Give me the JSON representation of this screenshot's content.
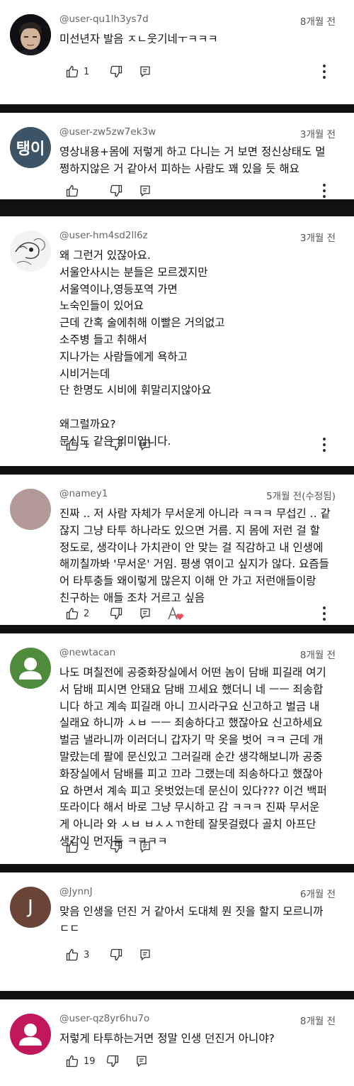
{
  "comments": [
    {
      "handle": "@user-qu1lh3ys7d",
      "time": "8개월 전",
      "text": "미선년자 발음 ㅈㄴ웃기네ㅜㅋㅋㅋ",
      "likes": "1",
      "avatar": "photo-portrait"
    },
    {
      "handle": "@user-zw5zw7ek3w",
      "time": "3개월 전",
      "text": "영상내용+몸에 저렇게 하고 다니는 거 보면 정신상태도 멀\n쩡하지않은 거 같아서 피하는 사람도 꽤 있을 듯 해요",
      "likes": "",
      "avatar_text": "탱이",
      "avatar_color": "#3d5466"
    },
    {
      "handle": "@user-hm4sd2ll6z",
      "time": "3개월 전",
      "text": "왜 그런거 있잖아요.\n서울안사시는 분들은 모르겠지만\n서울역이나,영등포역 가면\n노숙인들이 있어요\n근데 간혹 술에취해 이빨은 거의없고\n소주병 들고 취해서\n지나가는 사람들에게 욕하고\n시비거는데\n단 한명도 시비에 휘말리지않아요\n\n왜그럴까요?\n문신도 같은 의미입니다.",
      "likes": "1",
      "avatar": "sketch-drawing"
    },
    {
      "handle": "@namey1",
      "time": "5개월 전(수정됨)",
      "text": "진짜 .. 저 사람 자체가 무서운게 아니라 ㅋㅋㅋ 무섭긴 .. 같\n잖지 그냥 타투 하나라도 있으면 거름. 지 몸에 저런 걸 할\n정도로, 생각이나 가치관이 안 맞는 걸 직감하고 내 인생에\n해끼칠까봐 '무서운' 거임. 평생 엮이고 싶지가 않다. 요즘들\n어 타투충들 왜이렇게 많은지 이해 안 가고 저런애들이랑\n친구하는 애들 조차 거르고 싶음",
      "likes": "2",
      "avatar_color": "#b39a98",
      "creator_heart": true
    },
    {
      "handle": "@newtacan",
      "time": "8개월 전",
      "text": "나도 며칠전에 공중화장실에서 어떤 놈이 담배 피길래 여기\n서 담배 피시면 안돼요 담배 끄세요 했더니 네 ㅡㅡ 죄송합\n니다 하고 계속 피길래 아니 끄시라구요 신고하고 벌금 내\n실래요 하니까 ㅅㅂ ㅡㅡ 죄송하다고 했잖아요 신고하세요\n벌금 낼라니까 이러더니 갑자기 막 옷을 벗어 ㅋㅋ 근데 개\n말랐는데 팔에 문신있고 그러길래 순간 생각해보니까 공중\n화장실에서 담배를 피고 끄라 그랬는데 죄송하다고 했잖아\n요 하면서 계속 피고 옷벗었는데 문신이 있다??? 이건 백퍼\n또라이다 해서 바로 그냥 무시하고 감 ㅋㅋㅋ 진짜 무서운\n게 아니라 와 ㅅㅂ ㅂㅅㅅㄲ한테 잘못걸렸다 골치 아프단\n생각이 먼저듬 ㅋㅋㅋㅋ",
      "likes": "2",
      "avatar": "default-person",
      "avatar_color": "#4f8b3c"
    },
    {
      "handle": "@JynnJ",
      "time": "6개월 전",
      "text": "맞음 인생을 던진 거 같아서 도대체 뭔 짓을 할지 모르니까\nㄷㄷ",
      "likes": "3",
      "avatar_text": "J",
      "avatar_color": "#6b4438"
    },
    {
      "handle": "@user-qz8yr6hu7o",
      "time": "8개월 전",
      "text": "저렇게 타투하는거면 정말 인생 던진거 아니야?",
      "likes": "19",
      "avatar": "default-person",
      "avatar_color": "#c2185b"
    }
  ],
  "icons": {
    "like": "thumbs-up-icon",
    "dislike": "thumbs-down-icon",
    "reply": "reply-icon",
    "more": "more-vertical-icon"
  }
}
